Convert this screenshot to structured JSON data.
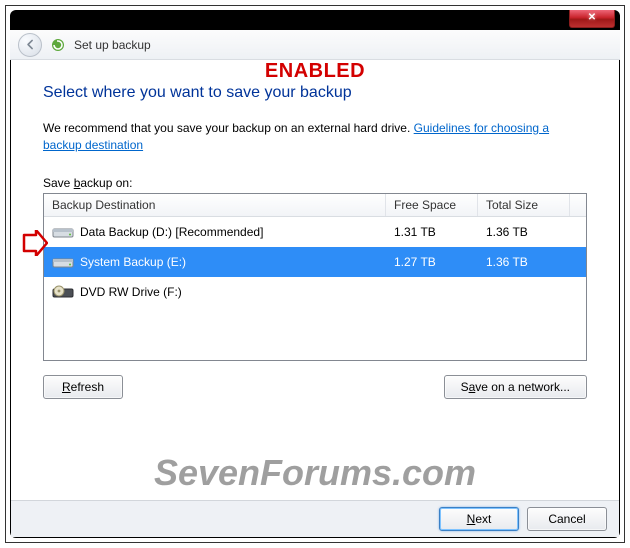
{
  "window": {
    "title": "Set up backup",
    "close_label": "✕"
  },
  "annotation": {
    "enabled": "ENABLED"
  },
  "heading": "Select where you want to save your backup",
  "recommend_text": "We recommend that you save your backup on an external hard drive. ",
  "guidelines_link": "Guidelines for choosing a backup destination",
  "save_on_label_pre": "Save ",
  "save_on_label_u": "b",
  "save_on_label_post": "ackup on:",
  "columns": {
    "dest": "Backup Destination",
    "free": "Free Space",
    "size": "Total Size"
  },
  "drives": [
    {
      "name": "Data Backup (D:) [Recommended]",
      "free": "1.31 TB",
      "size": "1.36 TB",
      "type": "hdd",
      "selected": false
    },
    {
      "name": "System Backup (E:)",
      "free": "1.27 TB",
      "size": "1.36 TB",
      "type": "hdd",
      "selected": true
    },
    {
      "name": "DVD RW Drive (F:)",
      "free": "",
      "size": "",
      "type": "dvd",
      "selected": false
    }
  ],
  "buttons": {
    "refresh_u": "R",
    "refresh_rest": "efresh",
    "network_pre": "S",
    "network_u": "a",
    "network_post": "ve on a network...",
    "next_u": "N",
    "next_rest": "ext",
    "cancel": "Cancel"
  },
  "watermark": "SevenForums.com"
}
